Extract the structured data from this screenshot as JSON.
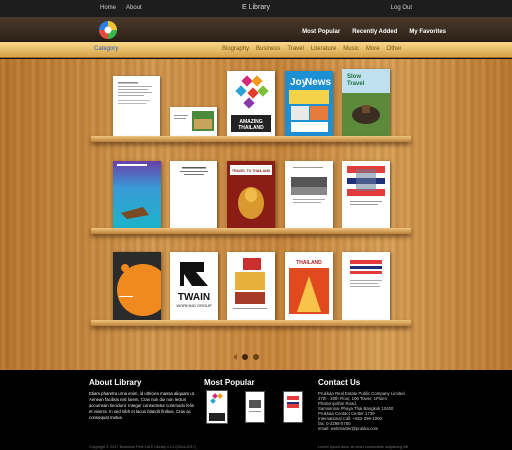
{
  "topbar": {
    "nav": [
      "Home",
      "About"
    ],
    "title": "E Library",
    "logout": "Log Out"
  },
  "header": {
    "links": [
      "Most Popular",
      "Recently Added",
      "My Favorites"
    ]
  },
  "categories": {
    "button": "Category",
    "items": [
      "Biography",
      "Business",
      "Travel",
      "Literature",
      "Music",
      "More",
      "Other"
    ]
  },
  "shelf1": [
    {
      "name": "book-document-white",
      "text": ""
    },
    {
      "name": "book-small-card",
      "text": ""
    },
    {
      "name": "book-amazing-thailand",
      "text": "AMAZING AMAZING THAILAND"
    },
    {
      "name": "book-joy-news",
      "text": "Joy News"
    },
    {
      "name": "book-slow-travel-thailand",
      "text": "Slow Travel Thailand"
    }
  ],
  "shelf2": [
    {
      "name": "book-beach-island",
      "text": ""
    },
    {
      "name": "book-document-text",
      "text": ""
    },
    {
      "name": "book-buddha-travel",
      "text": "TRAVEL TO THAILAND"
    },
    {
      "name": "book-document-photo",
      "text": ""
    },
    {
      "name": "book-thai-flag",
      "text": ""
    }
  ],
  "shelf3": [
    {
      "name": "book-orange-circle",
      "text": ""
    },
    {
      "name": "book-twain-working-group",
      "text": "TWAIN WORKING GROUP"
    },
    {
      "name": "book-thai-magazine",
      "text": ""
    },
    {
      "name": "book-thailand-red",
      "text": "THAILAND"
    },
    {
      "name": "book-document-flag",
      "text": ""
    }
  ],
  "pagination": {
    "pages": 2,
    "current": 1
  },
  "footer": {
    "about_title": "About Library",
    "about_text": "Etiam pharetra urna enim, id ultricies massa aliquam ut. Aenean facilisis nisl lorem. Cras non dui non lectus accumsan tincidunt. Integer consectetur commodo felis et viverra. In sed nibh et lacus blandit finibus. Cras ac consequat metus.",
    "popular_title": "Most Popular",
    "contact_title": "Contact Us",
    "contact_lines": [
      "Prukkaa Real Estate Public Company Limited",
      "27th - 30th Floor, 100 Tower, 1Ploen",
      "Phahonyothin Road,",
      "Samsennai Phaya Thai Bangkok 10400",
      "Prukkaa Contact Center 1739",
      "International Call: +662-299-1000",
      "fax: 0-2298-0750",
      "email: webmaster@prukka.com"
    ],
    "copyright_left": "Copyright © 2017 Business First Ltd E Library v1.0 (2014-2017)",
    "copyright_right": "Lorem ipsum dolor sit amet consectetur adipiscing elit"
  },
  "colors": {
    "wood": "#c98a3e",
    "catbar": "#f0c06a",
    "footer": "#000000",
    "category_link": "#2c5fb3"
  }
}
